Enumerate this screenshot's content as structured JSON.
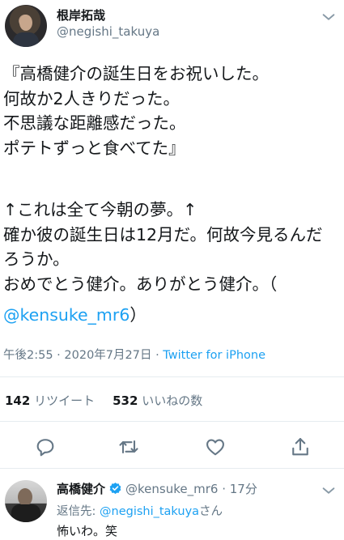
{
  "tweet": {
    "author_name": "根岸拓哉",
    "author_handle": "@negishi_takuya",
    "body_part1": "『高橋健介の誕生日をお祝いした。\n何故か2人きりだった。\n不思議な距離感だった。\nポテトずっと食べてた』",
    "body_part2": "↑これは全て今朝の夢。↑\n確か彼の誕生日は12月だ。何故今見るんだろうか。\nおめでとう健介。ありがとう健介。（",
    "mention": "@kensuke_mr6",
    "mention_close": "）",
    "timestamp": "午後2:55 · 2020年7月27日 · ",
    "source": "Twitter for iPhone",
    "retweets_count": "142",
    "retweets_label": "リツイート",
    "likes_count": "532",
    "likes_label": "いいねの数"
  },
  "reply": {
    "author_name": "高橋健介",
    "author_handle": "@kensuke_mr6",
    "time": " · 17分",
    "reply_to_prefix": "返信先: ",
    "reply_to_handle": "@negishi_takuya",
    "reply_to_suffix": "さん",
    "text": "怖いわ。笑"
  },
  "colors": {
    "accent": "#1da1f2",
    "muted": "#657786",
    "text": "#14171a",
    "divider": "#e6ecf0"
  },
  "icons": [
    "chevron-down-icon",
    "reply-icon",
    "retweet-icon",
    "like-icon",
    "share-icon",
    "verified-badge-icon"
  ]
}
